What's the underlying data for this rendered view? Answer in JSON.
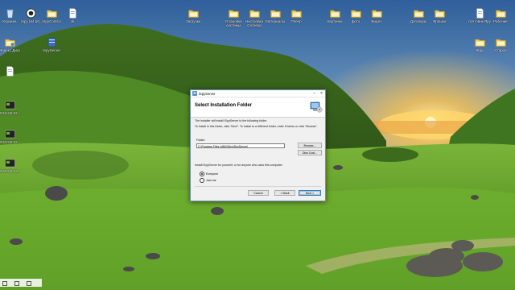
{
  "desktop": {
    "icons_left": [
      {
        "label": "Корзина",
        "icon": "recycle-bin-icon"
      },
      {
        "label": "iSpy (64 bit)",
        "icon": "ispy-eye-icon"
      },
      {
        "label": "iSpyControl",
        "icon": "folder-icon"
      },
      {
        "label": "vk",
        "icon": "document-icon"
      },
      {
        "label": "Яндекс.Диск",
        "icon": "yandex-disk-folder-icon"
      },
      {
        "label": "iSpyServer",
        "icon": "ispy-server-icon"
      },
      {
        "label": "",
        "icon": "document-icon"
      },
      {
        "label": "2018-06-02...",
        "icon": "screenshot-file-icon"
      },
      {
        "label": "2018-06-02...",
        "icon": "screenshot-file-icon"
      },
      {
        "label": "2018-06-02...",
        "icon": "screenshot-file-icon"
      }
    ],
    "icons_top": [
      {
        "label": "Загрузки",
        "icon": "folder-icon"
      },
      {
        "label": "Установка системы",
        "icon": "folder-icon"
      },
      {
        "label": "Настройка Сетевой",
        "icon": "folder-icon"
      },
      {
        "label": "Материалы",
        "icon": "folder-icon"
      },
      {
        "label": "Плеер",
        "icon": "folder-icon"
      },
      {
        "label": "Картинки",
        "icon": "folder-icon"
      },
      {
        "label": "фото",
        "icon": "folder-icon"
      },
      {
        "label": "Видео",
        "icon": "folder-icon"
      },
      {
        "label": "Договоры",
        "icon": "folder-icon"
      },
      {
        "label": "Ярлыки",
        "icon": "folder-icon"
      },
      {
        "label": "почтовик Яру",
        "icon": "document-icon"
      },
      {
        "label": "Рабочие",
        "icon": "folder-icon"
      },
      {
        "label": "Игры",
        "icon": "folder-icon"
      },
      {
        "label": "Старое",
        "icon": "folder-icon"
      }
    ]
  },
  "dialog": {
    "window_title": "iSpyServer",
    "heading": "Select Installation Folder",
    "intro": "The installer will install iSpyServer to the following folder.",
    "instructions": "To install in this folder, click \"Next\". To install to a different folder, enter it below or click \"Browse\".",
    "folder_label": "Folder:",
    "folder_value": "C:\\Program Files (x86)\\iSpy\\iSpyServer\\",
    "browse_label": "Browse...",
    "disk_cost_label": "Disk Cost...",
    "install_for_label": "Install iSpyServer for yourself, or for anyone who uses this computer:",
    "options": [
      {
        "label": "Everyone",
        "selected": true
      },
      {
        "label": "Just me",
        "selected": false
      }
    ],
    "cancel_label": "Cancel",
    "back_label": "< Back",
    "next_label": "Next >"
  },
  "colors": {
    "sky_top": "#3a6fa8",
    "sky_horizon": "#f3b24a",
    "sun": "#ffe98a",
    "grass": "#5e9a22",
    "accent_border": "#3c7fb1"
  }
}
